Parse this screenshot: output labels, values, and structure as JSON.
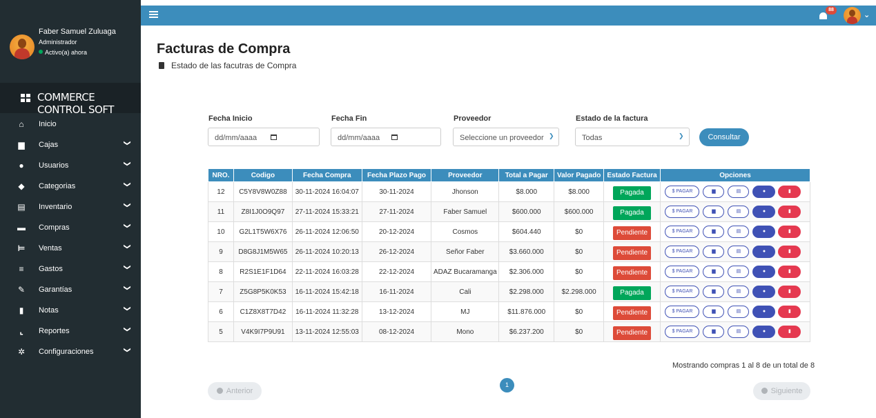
{
  "user": {
    "name": "Faber Samuel Zuluaga",
    "role": "Administrador",
    "status": "Activo(a) ahora"
  },
  "brand": {
    "text": "COMMERCE CONTROL SOFT"
  },
  "sidebar": {
    "items": [
      {
        "label": "Inicio",
        "icon": "home-icon",
        "glyph": "⌂",
        "chevron": ""
      },
      {
        "label": "Cajas",
        "icon": "cash-register-icon",
        "glyph": "▆",
        "chevron": "❯"
      },
      {
        "label": "Usuarios",
        "icon": "users-icon",
        "glyph": "●",
        "chevron": "❯"
      },
      {
        "label": "Categorias",
        "icon": "tags-icon",
        "glyph": "◆",
        "chevron": "❯"
      },
      {
        "label": "Inventario",
        "icon": "box-icon",
        "glyph": "▤",
        "chevron": "❯"
      },
      {
        "label": "Compras",
        "icon": "purchase-icon",
        "glyph": "▬",
        "chevron": "❯"
      },
      {
        "label": "Ventas",
        "icon": "cart-icon",
        "glyph": "⊨",
        "chevron": "❯"
      },
      {
        "label": "Gastos",
        "icon": "coins-icon",
        "glyph": "≡",
        "chevron": "❯"
      },
      {
        "label": "Garantías",
        "icon": "wrench-icon",
        "glyph": "✎",
        "chevron": "❯"
      },
      {
        "label": "Notas",
        "icon": "file-invoice-icon",
        "glyph": "▮",
        "chevron": "❯"
      },
      {
        "label": "Reportes",
        "icon": "chart-line-icon",
        "glyph": "⌞",
        "chevron": "❯"
      },
      {
        "label": "Configuraciones",
        "icon": "cogs-icon",
        "glyph": "✲",
        "chevron": "❯"
      }
    ]
  },
  "topbar": {
    "notifications": "88"
  },
  "header": {
    "title": "Facturas de Compra",
    "subtitle": "Estado de las facutras de Compra"
  },
  "filters": {
    "fecha_inicio": {
      "label": "Fecha Inicio",
      "placeholder": "dd/mm/aaaa"
    },
    "fecha_fin": {
      "label": "Fecha Fin",
      "placeholder": "dd/mm/aaaa"
    },
    "proveedor": {
      "label": "Proveedor",
      "value": "Seleccione un proveedor"
    },
    "estado": {
      "label": "Estado de la factura",
      "value": "Todas"
    },
    "submit": "Consultar"
  },
  "table": {
    "columns": [
      "NRO.",
      "Codigo",
      "Fecha Compra",
      "Fecha Plazo Pago",
      "Proveedor",
      "Total a Pagar",
      "Valor Pagado",
      "Estado Factura",
      "Opciones"
    ],
    "option_labels": {
      "pagar": "$ PAGAR",
      "a": "▆",
      "b": "▤",
      "c": "●",
      "d": "▮"
    },
    "rows": [
      {
        "nro": "12",
        "codigo": "C5Y8V8W0Z88",
        "fecha": "30-11-2024 16:04:07",
        "plazo": "30-11-2024",
        "proveedor": "Jhonson",
        "total": "$8.000",
        "pagado": "$8.000",
        "estado": "Pagada"
      },
      {
        "nro": "11",
        "codigo": "Z8I1J0O9Q97",
        "fecha": "27-11-2024 15:33:21",
        "plazo": "27-11-2024",
        "proveedor": "Faber Samuel",
        "total": "$600.000",
        "pagado": "$600.000",
        "estado": "Pagada"
      },
      {
        "nro": "10",
        "codigo": "G2L1T5W6X76",
        "fecha": "26-11-2024 12:06:50",
        "plazo": "20-12-2024",
        "proveedor": "Cosmos",
        "total": "$604.440",
        "pagado": "$0",
        "estado": "Pendiente"
      },
      {
        "nro": "9",
        "codigo": "D8G8J1M5W65",
        "fecha": "26-11-2024 10:20:13",
        "plazo": "26-12-2024",
        "proveedor": "Señor Faber",
        "total": "$3.660.000",
        "pagado": "$0",
        "estado": "Pendiente"
      },
      {
        "nro": "8",
        "codigo": "R2S1E1F1D64",
        "fecha": "22-11-2024 16:03:28",
        "plazo": "22-12-2024",
        "proveedor": "ADAZ Bucaramanga",
        "total": "$2.306.000",
        "pagado": "$0",
        "estado": "Pendiente"
      },
      {
        "nro": "7",
        "codigo": "Z5G8P5K0K53",
        "fecha": "16-11-2024 15:42:18",
        "plazo": "16-11-2024",
        "proveedor": "Cali",
        "total": "$2.298.000",
        "pagado": "$2.298.000",
        "estado": "Pagada"
      },
      {
        "nro": "6",
        "codigo": "C1Z8X8T7D42",
        "fecha": "16-11-2024 11:32:28",
        "plazo": "13-12-2024",
        "proveedor": "MJ",
        "total": "$11.876.000",
        "pagado": "$0",
        "estado": "Pendiente"
      },
      {
        "nro": "5",
        "codigo": "V4K9I7P9U91",
        "fecha": "13-11-2024 12:55:03",
        "plazo": "08-12-2024",
        "proveedor": "Mono",
        "total": "$6.237.200",
        "pagado": "$0",
        "estado": "Pendiente"
      }
    ]
  },
  "footer": {
    "showing": "Mostrando compras 1 al 8 de un total de 8",
    "prev": "Anterior",
    "next": "Siguiente",
    "page": "1"
  },
  "colors": {
    "primary": "#3c8dbc",
    "sidebar": "#222d32",
    "success": "#00a65a",
    "danger": "#dd4b39",
    "indigo": "#3f51b5"
  }
}
